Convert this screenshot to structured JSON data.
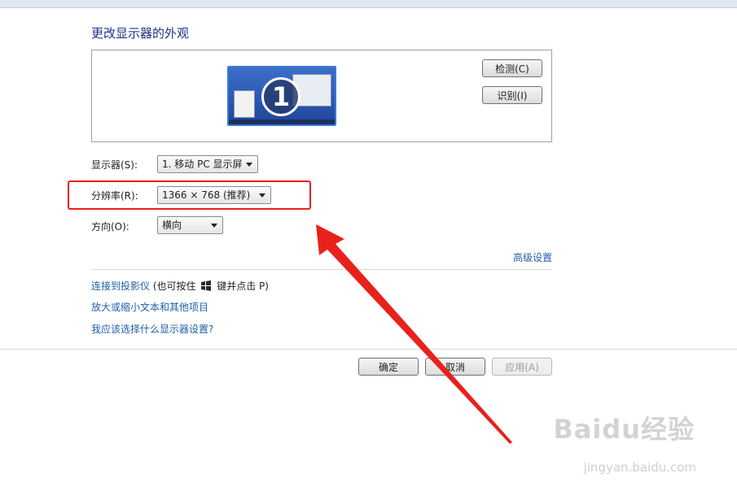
{
  "header": {
    "title": "更改显示器的外观"
  },
  "preview": {
    "monitor_number": "1"
  },
  "buttons": {
    "detect": "检测(C)",
    "identify": "识别(I)",
    "ok": "确定",
    "cancel": "取消",
    "apply": "应用(A)"
  },
  "settings": {
    "display_label": "显示器(S):",
    "display_value": "1. 移动 PC 显示屏",
    "resolution_label": "分辨率(R):",
    "resolution_value": "1366 × 768 (推荐)",
    "orientation_label": "方向(O):",
    "orientation_value": "横向"
  },
  "links": {
    "advanced": "高级设置",
    "projector": "连接到投影仪",
    "projector_hint_pre": "(也可按住",
    "projector_hint_post": "键并点击 P)",
    "zoom": "放大或缩小文本和其他项目",
    "help": "我应该选择什么显示器设置?"
  },
  "watermark": {
    "brand": "Baidu经验",
    "url": "jingyan.baidu.com"
  },
  "annotation": {
    "highlight_color": "#e8211c",
    "arrow_color": "#e8211c"
  }
}
